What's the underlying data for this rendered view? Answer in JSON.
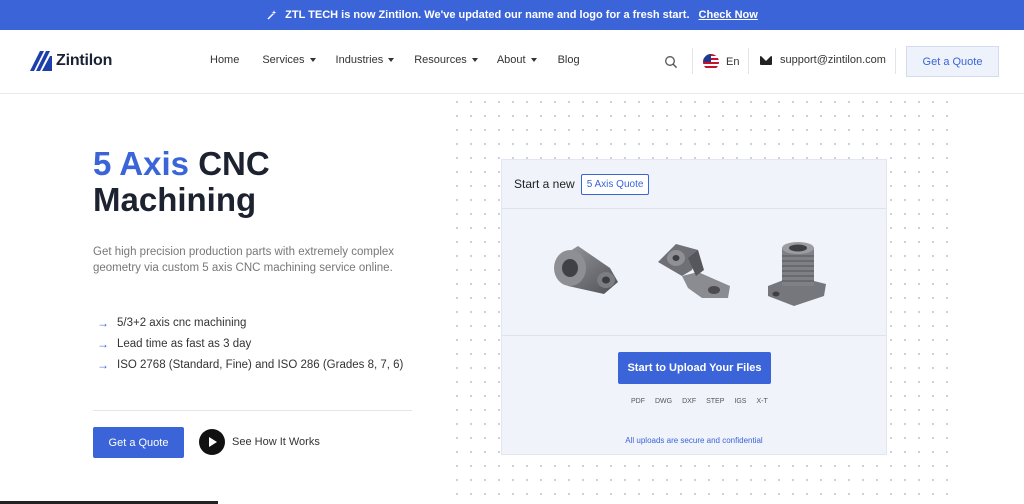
{
  "banner": {
    "message": "ZTL TECH is now Zintilon. We've updated our name and logo for a fresh start.",
    "link": "Check Now"
  },
  "header": {
    "brand": "Zintilon",
    "nav": [
      {
        "label": "Home",
        "dropdown": false
      },
      {
        "label": "Services",
        "dropdown": true
      },
      {
        "label": "Industries",
        "dropdown": true
      },
      {
        "label": "Resources",
        "dropdown": true
      },
      {
        "label": "About",
        "dropdown": true
      },
      {
        "label": "Blog",
        "dropdown": false
      }
    ],
    "language": "En",
    "email": "support@zintilon.com",
    "quote_button": "Get a Quote"
  },
  "hero": {
    "title_accent": "5 Axis",
    "title_rest_1": "CNC",
    "title_rest_2": "Machining",
    "description": "Get high precision production parts with extremely complex geometry via custom 5 axis CNC machining service online.",
    "features": [
      "5/3+2  axis cnc machining",
      "Lead time as fast as 3 day",
      "ISO 2768 (Standard, Fine) and ISO 286 (Grades 8, 7, 6)"
    ],
    "cta": "Get a Quote",
    "watch": "See How It Works"
  },
  "quote_card": {
    "heading": "Start a new",
    "chip": "5 Axis Quote",
    "upload_button": "Start to Upload Your Files",
    "formats": [
      "PDF",
      "DWG",
      "DXF",
      "STEP",
      "IGS",
      "X-T"
    ],
    "secure_note": "All uploads are secure and confidential"
  },
  "colors": {
    "accent": "#3a64d8",
    "text": "#1d2230"
  }
}
